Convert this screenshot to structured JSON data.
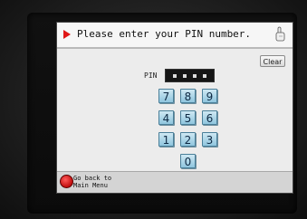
{
  "header": {
    "prompt": "Please enter your PIN number."
  },
  "pin": {
    "label": "PIN",
    "entered_digits": 4
  },
  "clear_button": {
    "label": "Clear"
  },
  "keypad": {
    "rows": [
      [
        "7",
        "8",
        "9"
      ],
      [
        "4",
        "5",
        "6"
      ],
      [
        "1",
        "2",
        "3"
      ],
      [
        "0"
      ]
    ]
  },
  "footer": {
    "back_label": "Go back to Main Menu"
  },
  "colors": {
    "accent": "#e01616",
    "key_fill": "#a8d4e8",
    "screen_bg": "#ececec"
  },
  "icons": [
    "red-arrow-icon",
    "finger-icon",
    "red-circle-back-icon"
  ]
}
